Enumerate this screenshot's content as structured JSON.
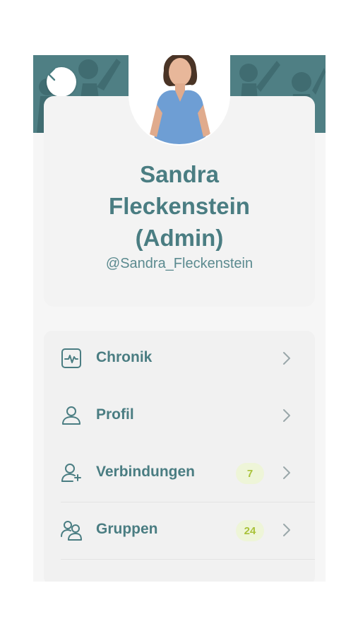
{
  "profile": {
    "name_line1": "Sandra",
    "name_line2": "Fleckenstein",
    "name_line3": "(Admin)",
    "handle": "@Sandra_Fleckenstein"
  },
  "menu": {
    "items": [
      {
        "label": "Chronik",
        "icon": "activity-icon"
      },
      {
        "label": "Profil",
        "icon": "user-icon"
      },
      {
        "label": "Verbindungen",
        "icon": "add-user-icon",
        "badge": "7"
      },
      {
        "label": "Gruppen",
        "icon": "group-icon",
        "badge": "24"
      }
    ]
  },
  "colors": {
    "accent": "#4a7d82",
    "banner": "#4f7f84",
    "badge_bg": "#eef5d8",
    "badge_text": "#a9c23a"
  }
}
